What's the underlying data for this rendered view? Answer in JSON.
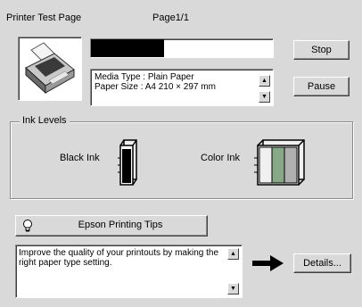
{
  "header": {
    "title": "Printer Test Page",
    "page": "Page1/1"
  },
  "status": {
    "progress": 0.4,
    "media_type": "Media Type : Plain Paper",
    "paper_size": "Paper Size : A4 210 × 297 mm"
  },
  "buttons": {
    "stop": "Stop",
    "pause": "Pause",
    "tips": "Epson Printing Tips",
    "details": "Details..."
  },
  "ink": {
    "group_label": "Ink Levels",
    "black_label": "Black Ink",
    "color_label": "Color Ink",
    "black_level": 0.95,
    "color_colors": [
      "#f0f0f0",
      "#88a888",
      "#b0b0b0"
    ]
  },
  "tip_text": "Improve the quality of your printouts by making the right paper type setting.",
  "icons": {
    "printer": "printer-icon",
    "bulb": "lightbulb-icon",
    "arrow": "right-arrow-icon",
    "scroll_up": "scroll-up-icon",
    "scroll_down": "scroll-down-icon"
  }
}
